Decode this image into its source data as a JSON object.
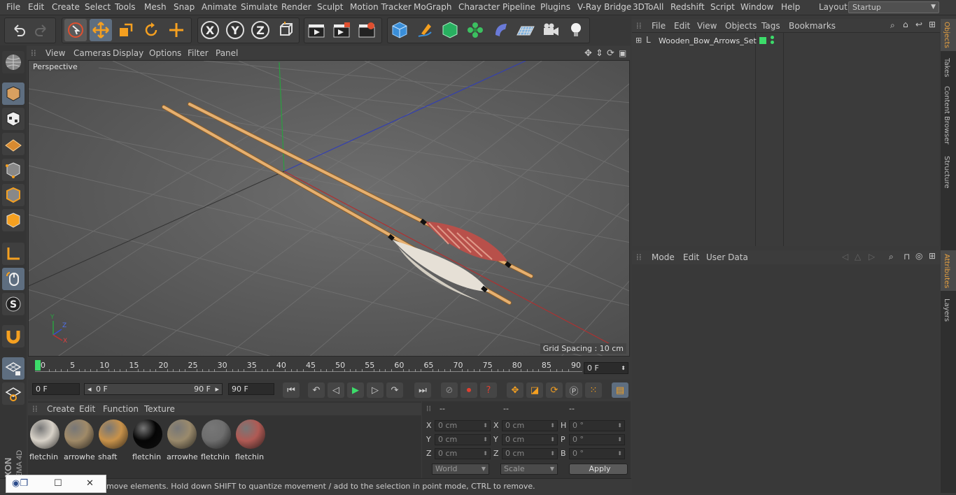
{
  "menubar": {
    "items": [
      "File",
      "Edit",
      "Create",
      "Select",
      "Tools",
      "Mesh",
      "Snap",
      "Animate",
      "Simulate",
      "Render",
      "Sculpt",
      "Motion Tracker",
      "MoGraph",
      "Character",
      "Pipeline",
      "Plugins",
      "V-Ray Bridge",
      "3DToAll",
      "Redshift",
      "Script",
      "Window",
      "Help"
    ],
    "layout_label": "Layout:",
    "layout_value": "Startup"
  },
  "viewport": {
    "menu": [
      "View",
      "Cameras",
      "Display",
      "Options",
      "Filter",
      "Panel"
    ],
    "label": "Perspective",
    "grid_spacing": "Grid Spacing : 10 cm",
    "axis_labels": {
      "y": "Y",
      "z": "Z",
      "x": "X"
    }
  },
  "timeline": {
    "ticks": [
      "0",
      "5",
      "10",
      "15",
      "20",
      "25",
      "30",
      "35",
      "40",
      "45",
      "50",
      "55",
      "60",
      "65",
      "70",
      "75",
      "80",
      "85",
      "90"
    ],
    "current_frame": "0 F"
  },
  "anim": {
    "start": "0 F",
    "range_start": "0 F",
    "range_end": "90 F",
    "end": "90 F"
  },
  "materials": {
    "menu": [
      "Create",
      "Edit",
      "Function",
      "Texture"
    ],
    "items": [
      {
        "name": "fletchin",
        "color": "#d8d2c8"
      },
      {
        "name": "arrowhe",
        "color": "#a08a68"
      },
      {
        "name": "shaft",
        "color": "#c8924a"
      },
      {
        "name": "fletchin",
        "color": "#050505"
      },
      {
        "name": "arrowhe",
        "color": "#9a8a6c"
      },
      {
        "name": "fletchin",
        "color": "#6e6e6e"
      },
      {
        "name": "fletchin",
        "color": "#b05a54"
      }
    ]
  },
  "coords": {
    "headers": [
      "--",
      "--",
      "--"
    ],
    "rows": [
      {
        "a": "X",
        "av": "0 cm",
        "b": "X",
        "bv": "0 cm",
        "c": "H",
        "cv": "0 °"
      },
      {
        "a": "Y",
        "av": "0 cm",
        "b": "Y",
        "bv": "0 cm",
        "c": "P",
        "cv": "0 °"
      },
      {
        "a": "Z",
        "av": "0 cm",
        "b": "Z",
        "bv": "0 cm",
        "c": "B",
        "cv": "0 °"
      }
    ],
    "world": "World",
    "scale": "Scale",
    "apply": "Apply"
  },
  "status": "move elements. Hold down SHIFT to quantize movement / add to the selection in point mode, CTRL to remove.",
  "object_manager": {
    "menu": [
      "File",
      "Edit",
      "View",
      "Objects",
      "Tags",
      "Bookmarks"
    ],
    "objects": [
      "Wooden_Bow_Arrows_Set"
    ]
  },
  "attribute_manager": {
    "menu": [
      "Mode",
      "Edit",
      "User Data"
    ]
  },
  "right_tabs": [
    "Objects",
    "Takes",
    "Content Browser",
    "Structure",
    "Attributes",
    "Layers"
  ],
  "brand": "MAXON CINEMA 4D"
}
